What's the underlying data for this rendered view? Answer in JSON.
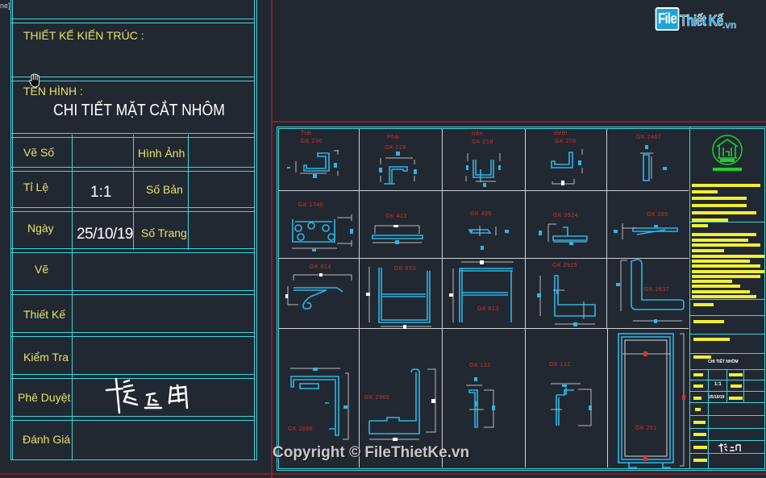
{
  "corner_label": "ne]",
  "title_block": {
    "architect_label": "THIẾT KẾ KIẾN TRÚC :",
    "drawing_name_label": "TÊN HÌNH :",
    "drawing_name": "CHI TIẾT MẶT CẮT NHÔM",
    "rows": [
      {
        "label": "Vẽ Số",
        "value": "",
        "label2": "Hình Ảnh",
        "value2": ""
      },
      {
        "label": "Tỉ Lệ",
        "value": "1:1",
        "label2": "Số Bản",
        "value2": ""
      },
      {
        "label": "Ngày",
        "value": "25/10/19",
        "label2": "Số Trang",
        "value2": ""
      },
      {
        "label": "Vẽ",
        "value": ""
      },
      {
        "label": "Thiết Kế",
        "value": ""
      },
      {
        "label": "Kiểm Tra",
        "value": ""
      },
      {
        "label": "Phê Duyệt",
        "value": "signature"
      },
      {
        "label": "Đánh Giá",
        "value": ""
      }
    ]
  },
  "watermark": {
    "logo_file": "File",
    "logo_rest": "Thiết Kế",
    "logo_tld": ".vn",
    "copyright": "Copyright © FileThietKe.vn"
  },
  "profiles": [
    {
      "id": "gk230",
      "caption_top": "Trái",
      "caption": "GK 230"
    },
    {
      "id": "gk228",
      "caption_top": "Phải",
      "caption": "GK 228"
    },
    {
      "id": "gk218",
      "caption_top": "trên",
      "caption": "GK 218"
    },
    {
      "id": "gk208",
      "caption_top": "dưới",
      "caption": "GK 208"
    },
    {
      "id": "gk2467",
      "caption_top": "",
      "caption": "GK 2467"
    },
    {
      "id": "gk1740",
      "caption_top": "",
      "caption": "GK 1740"
    },
    {
      "id": "gk413",
      "caption_top": "",
      "caption": "GK 413"
    },
    {
      "id": "gk495",
      "caption_top": "",
      "caption": "GK 495"
    },
    {
      "id": "gk3524",
      "caption_top": "",
      "caption": "GK 3524"
    },
    {
      "id": "gk285",
      "caption_top": "",
      "caption": "GK 285"
    },
    {
      "id": "gk614",
      "caption_top": "",
      "caption": "GK 614"
    },
    {
      "id": "gk853",
      "caption_top": "",
      "caption": "GK 853"
    },
    {
      "id": "gk813",
      "caption_top": "",
      "caption": "GK 813"
    },
    {
      "id": "gk2925",
      "caption_top": "",
      "caption": "GK 2925"
    },
    {
      "id": "gk2637",
      "caption_top": "",
      "caption": "GK 2637"
    },
    {
      "id": "gk2686",
      "caption_top": "",
      "caption": "GK 2686"
    },
    {
      "id": "gk2965",
      "caption_top": "",
      "caption": "GK 2965"
    },
    {
      "id": "gk122a",
      "caption_top": "",
      "caption": "GK 122"
    },
    {
      "id": "gk122b",
      "caption_top": "",
      "caption": "GK 122"
    },
    {
      "id": "gk281",
      "caption_top": "",
      "caption": "GK 281"
    }
  ],
  "mini_title_block": {
    "drawing_name": "CHI TIẾT NHÔM",
    "scale": "1:1",
    "date": "25/10/19"
  },
  "colors": {
    "background": "#222831",
    "frame_lines": "#3fd6de",
    "border_red": "#8e1d26",
    "label_yellow": "#e7e36b",
    "profile_blue": "#2bb6e6",
    "caption_red": "#d8302e",
    "logo_green": "#1fd12f"
  }
}
